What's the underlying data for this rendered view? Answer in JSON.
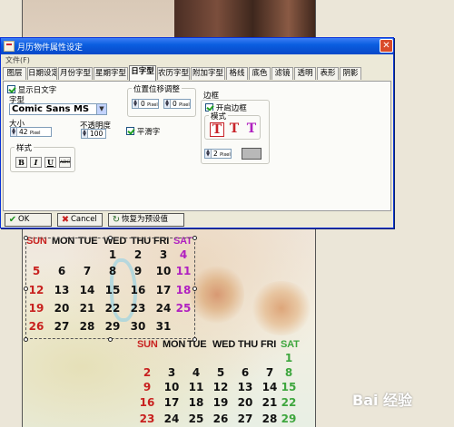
{
  "dialog": {
    "title": "月历物件属性设定",
    "menu": "文件(F)",
    "tabs": [
      "图层",
      "日期设定",
      "月份字型",
      "星期字型",
      "日字型",
      "农历字型",
      "附加字型",
      "格线",
      "底色",
      "滤镜",
      "透明",
      "表形",
      "阴影"
    ],
    "active_tab": "日字型",
    "show_day_text": "显示日文字",
    "font_label": "字型",
    "font_value": "Comic Sans MS",
    "size_label": "大小",
    "size_value": "42",
    "size_unit": "Pixel",
    "opacity_label": "不透明度",
    "opacity_value": "100",
    "style_label": "样式",
    "bold_glyph": "B",
    "italic_glyph": "I",
    "underline_glyph": "U",
    "strike_glyph": "ABC",
    "position_group": "位置位移调整",
    "pos_x_value": "0",
    "pos_y_value": "0",
    "unit_pixel": "Pixel",
    "smooth_label": "平滑字",
    "border_group": "边框",
    "enable_border": "开启边框",
    "mode_label": "模式",
    "border_width_value": "2",
    "border_unit": "Pixel",
    "border_color": "#b8b8b8",
    "ok": "OK",
    "cancel": "Cancel",
    "reset": "恢复为预设值"
  },
  "calendar": {
    "month1": {
      "headers": [
        {
          "t": "SUN",
          "c": "red"
        },
        {
          "t": "MON",
          "c": "blk"
        },
        {
          "t": "TUE",
          "c": "blk"
        },
        {
          "t": "WED",
          "c": "blk"
        },
        {
          "t": "THU",
          "c": "blk"
        },
        {
          "t": "FRI",
          "c": "blk"
        },
        {
          "t": "SAT",
          "c": "mag"
        }
      ],
      "rows": [
        [
          "",
          "",
          "",
          "1",
          "2",
          "3",
          "4"
        ],
        [
          "5",
          "6",
          "7",
          "8",
          "9",
          "10",
          "11"
        ],
        [
          "12",
          "13",
          "14",
          "15",
          "16",
          "17",
          "18"
        ],
        [
          "19",
          "20",
          "21",
          "22",
          "23",
          "24",
          "25"
        ],
        [
          "26",
          "27",
          "28",
          "29",
          "30",
          "31",
          ""
        ]
      ]
    },
    "month2": {
      "headers": [
        {
          "t": "SUN",
          "c": "red"
        },
        {
          "t": "MON",
          "c": "blk"
        },
        {
          "t": "TUE",
          "c": "blk"
        },
        {
          "t": "WED",
          "c": "blk"
        },
        {
          "t": "THU",
          "c": "blk"
        },
        {
          "t": "FRI",
          "c": "blk"
        },
        {
          "t": "SAT",
          "c": "grn"
        }
      ],
      "rows": [
        [
          "",
          "",
          "",
          "",
          "",
          "",
          "1"
        ],
        [
          "2",
          "3",
          "4",
          "5",
          "6",
          "7",
          "8"
        ],
        [
          "9",
          "10",
          "11",
          "12",
          "13",
          "14",
          "15"
        ],
        [
          "16",
          "17",
          "18",
          "19",
          "20",
          "21",
          "22"
        ],
        [
          "23",
          "24",
          "25",
          "26",
          "27",
          "28",
          "29"
        ]
      ]
    }
  },
  "watermark": "Bai 经验"
}
